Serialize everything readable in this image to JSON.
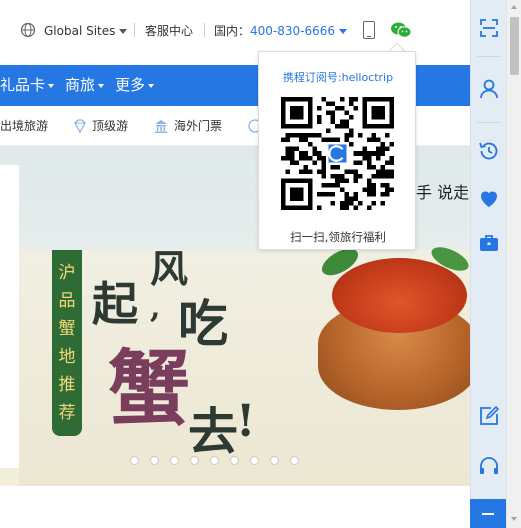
{
  "topbar": {
    "global_sites": "Global Sites",
    "customer_service": "客服中心",
    "domestic_label": "国内：",
    "phone": "400-830-6666"
  },
  "nav": {
    "items": [
      {
        "label": "礼品卡"
      },
      {
        "label": "商旅"
      },
      {
        "label": "更多"
      }
    ]
  },
  "subnav": {
    "items": [
      {
        "label": "出境旅游"
      },
      {
        "label": "顶级游"
      },
      {
        "label": "海外门票"
      }
    ]
  },
  "banner": {
    "vertical_text": [
      "沪",
      "品",
      "蟹",
      "地",
      "推",
      "荐"
    ],
    "headline_chars": [
      "风",
      "起",
      ",",
      "吃",
      "蟹",
      "去",
      "!"
    ],
    "right_text": "手 说走",
    "slide_count": 9
  },
  "popup": {
    "title": "携程订阅号:helloctrip",
    "caption": "扫一扫,领旅行福利"
  },
  "colors": {
    "brand_blue": "#2577e3",
    "sidebar_bg": "#e3ecf5"
  }
}
